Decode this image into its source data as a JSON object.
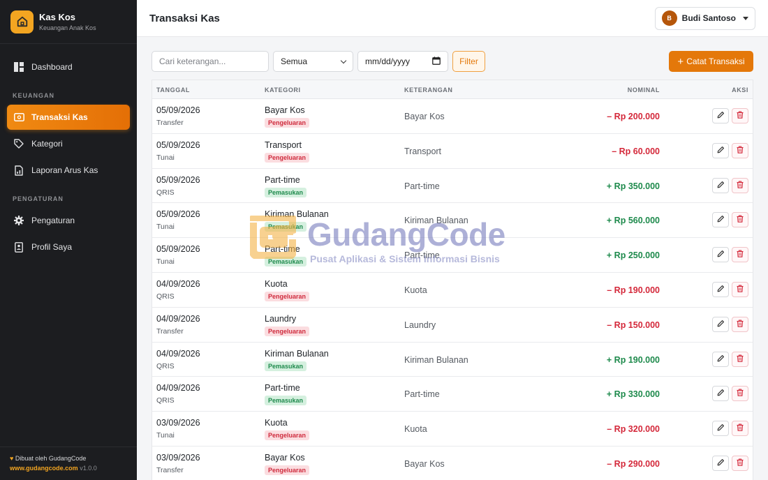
{
  "brand": {
    "name": "Kas Kos",
    "subtitle": "Keuangan Anak Kos"
  },
  "sidebar": {
    "dashboard": "Dashboard",
    "section_keuangan": "KEUANGAN",
    "transaksi": "Transaksi Kas",
    "kategori": "Kategori",
    "laporan": "Laporan Arus Kas",
    "section_pengaturan": "PENGATURAN",
    "pengaturan": "Pengaturan",
    "profil": "Profil Saya",
    "footer_credit": "Dibuat oleh GudangCode",
    "footer_site": "www.gudangcode.com",
    "footer_version": "v1.0.0"
  },
  "header": {
    "title": "Transaksi Kas",
    "user_initial": "B",
    "user_name": "Budi Santoso"
  },
  "toolbar": {
    "search_placeholder": "Cari keterangan...",
    "select_value": "Semua",
    "date_placeholder": "mm/dd/yyyy",
    "filter_label": "Filter",
    "add_label": "Catat Transaksi"
  },
  "table": {
    "headers": {
      "date": "TANGGAL",
      "category": "KATEGORI",
      "description": "KETERANGAN",
      "amount": "NOMINAL",
      "action": "AKSI"
    },
    "rows": [
      {
        "date": "05/09/2026",
        "method": "Transfer",
        "category": "Bayar Kos",
        "badge": "Pengeluaran",
        "desc": "Bayar Kos",
        "amount": "– Rp 200.000",
        "type": "out"
      },
      {
        "date": "05/09/2026",
        "method": "Tunai",
        "category": "Transport",
        "badge": "Pengeluaran",
        "desc": "Transport",
        "amount": "– Rp 60.000",
        "type": "out"
      },
      {
        "date": "05/09/2026",
        "method": "QRIS",
        "category": "Part-time",
        "badge": "Pemasukan",
        "desc": "Part-time",
        "amount": "+ Rp 350.000",
        "type": "in"
      },
      {
        "date": "05/09/2026",
        "method": "Tunai",
        "category": "Kiriman Bulanan",
        "badge": "Pemasukan",
        "desc": "Kiriman Bulanan",
        "amount": "+ Rp 560.000",
        "type": "in"
      },
      {
        "date": "05/09/2026",
        "method": "Tunai",
        "category": "Part-time",
        "badge": "Pemasukan",
        "desc": "Part-time",
        "amount": "+ Rp 250.000",
        "type": "in"
      },
      {
        "date": "04/09/2026",
        "method": "QRIS",
        "category": "Kuota",
        "badge": "Pengeluaran",
        "desc": "Kuota",
        "amount": "– Rp 190.000",
        "type": "out"
      },
      {
        "date": "04/09/2026",
        "method": "Transfer",
        "category": "Laundry",
        "badge": "Pengeluaran",
        "desc": "Laundry",
        "amount": "– Rp 150.000",
        "type": "out"
      },
      {
        "date": "04/09/2026",
        "method": "QRIS",
        "category": "Kiriman Bulanan",
        "badge": "Pemasukan",
        "desc": "Kiriman Bulanan",
        "amount": "+ Rp 190.000",
        "type": "in"
      },
      {
        "date": "04/09/2026",
        "method": "QRIS",
        "category": "Part-time",
        "badge": "Pemasukan",
        "desc": "Part-time",
        "amount": "+ Rp 330.000",
        "type": "in"
      },
      {
        "date": "03/09/2026",
        "method": "Tunai",
        "category": "Kuota",
        "badge": "Pengeluaran",
        "desc": "Kuota",
        "amount": "– Rp 320.000",
        "type": "out"
      },
      {
        "date": "03/09/2026",
        "method": "Transfer",
        "category": "Bayar Kos",
        "badge": "Pengeluaran",
        "desc": "Bayar Kos",
        "amount": "– Rp 290.000",
        "type": "out"
      }
    ]
  },
  "watermark": {
    "title": "GudangCode",
    "subtitle": "Pusat Aplikasi & Sistem Informasi Bisnis"
  },
  "colors": {
    "accent": "#e4780a",
    "sidebar_bg": "#1c1d20",
    "expense": "#d4283a",
    "income": "#1e8a4c"
  },
  "icons": [
    "home-icon",
    "dashboard-icon",
    "wallet-icon",
    "tag-icon",
    "report-icon",
    "gear-icon",
    "profile-icon",
    "heart-icon",
    "calendar-icon",
    "chevron-down-icon",
    "plus-icon",
    "pencil-icon",
    "trash-icon"
  ]
}
